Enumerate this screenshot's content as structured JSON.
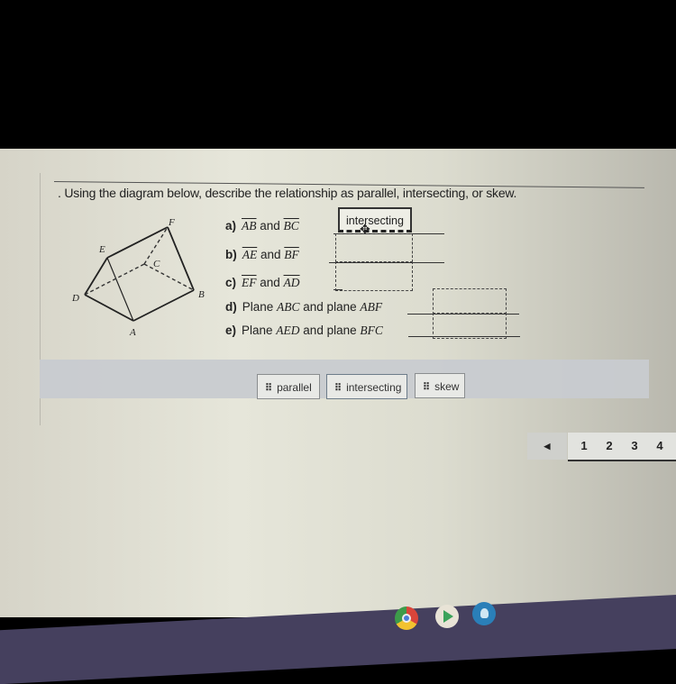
{
  "question": {
    "prompt": ". Using the diagram below, describe the relationship as parallel, intersecting, or skew."
  },
  "diagram": {
    "points": [
      "A",
      "B",
      "C",
      "D",
      "E",
      "F"
    ]
  },
  "items": [
    {
      "label": "a)",
      "pre": "",
      "s1": "AB",
      "mid": " and ",
      "s2": "BC",
      "answer": "intersecting"
    },
    {
      "label": "b)",
      "pre": "",
      "s1": "AE",
      "mid": " and ",
      "s2": "BF",
      "answer": ""
    },
    {
      "label": "c)",
      "pre": "",
      "s1": "EF",
      "mid": " and ",
      "s2": "AD",
      "answer": ""
    },
    {
      "label": "d)",
      "pre": "Plane ",
      "s1": "ABC",
      "mid": " and plane ",
      "s2": "ABF",
      "answer": ""
    },
    {
      "label": "e)",
      "pre": "Plane ",
      "s1": "AED",
      "mid": " and plane ",
      "s2": "BFC",
      "answer": ""
    }
  ],
  "word_bank": [
    "parallel",
    "intersecting",
    "skew"
  ],
  "pager": {
    "prev": "◀",
    "pages": [
      "1",
      "2",
      "3",
      "4"
    ]
  },
  "shelf": {
    "apps": [
      "chrome",
      "play-store",
      "app"
    ]
  }
}
